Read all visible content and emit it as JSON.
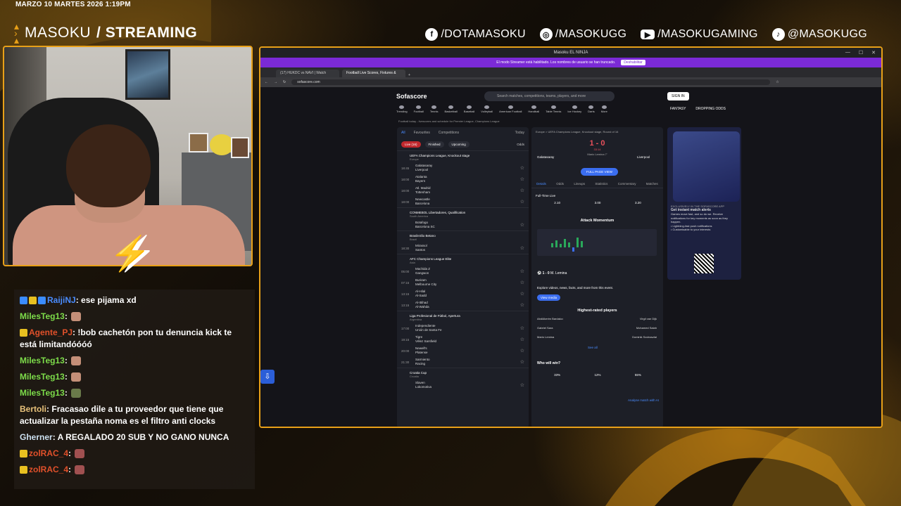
{
  "overlay": {
    "datetime": "MARZO 10 MARTES 2026 1:19PM",
    "brand_light": "MASOKU",
    "brand_bold": "/ STREAMING",
    "socials": [
      {
        "icon": "facebook-icon",
        "label": "/DOTAMASOKU"
      },
      {
        "icon": "instagram-icon",
        "label": "/MASOKUGG"
      },
      {
        "icon": "youtube-icon",
        "label": "/MASOKUGAMING"
      },
      {
        "icon": "tiktok-icon",
        "label": "@MASOKUGG"
      }
    ],
    "accent": "#e8a018"
  },
  "chat": {
    "messages": [
      {
        "user": "RaijiNJ",
        "color": "#4a8cff",
        "text": "ese pijama xd"
      },
      {
        "user": "MilesTeg13",
        "color": "#7ddc4a",
        "text": ""
      },
      {
        "user": "Agente_PJ",
        "color": "#e0502a",
        "text": "!bob cachetón pon tu denuncia kick te está limitandóóóó"
      },
      {
        "user": "MilesTeg13",
        "color": "#7ddc4a",
        "text": ""
      },
      {
        "user": "MilesTeg13",
        "color": "#7ddc4a",
        "text": ""
      },
      {
        "user": "MilesTeg13",
        "color": "#7ddc4a",
        "text": ""
      },
      {
        "user": "Bertoli",
        "color": "#e8c27a",
        "text": "Fracasao dile a tu proveedor que tiene que actualizar la pestaña noma es el filtro anti clocks"
      },
      {
        "user": "Gherner",
        "color": "#cde0f0",
        "text": "A REGALADO 20 SUB Y NO GANO NUNCA"
      },
      {
        "user": "zolRAC_4",
        "color": "#e0502a",
        "text": ""
      },
      {
        "user": "zolRAC_4",
        "color": "#e0502a",
        "text": ""
      }
    ]
  },
  "browser": {
    "title": "Masoku EL NINJA",
    "stream_notice": "El modo Streamer está habilitado. Los nombres de usuario se han truncado.",
    "stream_button": "Deshabilitar",
    "tabs": [
      "(17) HUKDC vs NAVI | Watch",
      "Football Live Scores, Fixtures &"
    ],
    "url": "sofascore.com"
  },
  "sofascore": {
    "logo": "Sofascore",
    "search_placeholder": "Search matches, competitions, teams, players, and more",
    "signin": "SIGN IN",
    "nav": [
      "Trending",
      "Football",
      "Tennis",
      "Basketball",
      "Baseball",
      "Volleyball",
      "American Football",
      "Handball",
      "Table Tennis",
      "Ice Hockey",
      "Darts",
      "More"
    ],
    "fantasy": "FANTASY",
    "dropping_odds": "DROPPING ODDS",
    "breadcrumb": "Football today - livescores and schedule for Premier League, Champions League",
    "match_tabs": [
      "All",
      "Favourites",
      "Competitions"
    ],
    "date_label": "Today",
    "filters": [
      "Live (16)",
      "Finished",
      "Upcoming"
    ],
    "odds_label": "Odds",
    "leagues": [
      {
        "name": "UEFA Champions League, Knockout stage",
        "region": "Europe",
        "games": [
          {
            "time": "18:45",
            "home": "Galatasaray",
            "away": "Liverpool"
          },
          {
            "time": "18:00",
            "home": "Atalanta",
            "away": "Bayern"
          },
          {
            "time": "18:00",
            "home": "Atl. Madrid",
            "away": "Tottenham"
          },
          {
            "time": "18:00",
            "home": "Newcastle",
            "away": "Barcelona"
          }
        ]
      },
      {
        "name": "CONMEBOL Libertadores, Qualification",
        "region": "South America",
        "games": [
          {
            "time": "",
            "home": "Botafogo",
            "away": "Barcelona SC"
          }
        ]
      },
      {
        "name": "Brasileirão Betano",
        "region": "Brazil",
        "games": [
          {
            "time": "18:30",
            "home": "Mirassol",
            "away": "Santos"
          }
        ]
      },
      {
        "name": "AFC Champions League Elite",
        "region": "Asia",
        "games": [
          {
            "time": "05:00",
            "home": "Machida Z",
            "away": "Gangwon"
          },
          {
            "time": "07:15",
            "home": "Buriram",
            "away": "Melbourne City"
          },
          {
            "time": "13:15",
            "home": "Al-Hilal",
            "away": "Al-Sadd"
          },
          {
            "time": "13:15",
            "home": "Al-Ittihad",
            "away": "Al-Wahda"
          }
        ]
      },
      {
        "name": "Liga Profesional de Fútbol, Apertura",
        "region": "Argentina",
        "games": [
          {
            "time": "17:00",
            "home": "Independiente",
            "away": "Unión de Santa Fe"
          },
          {
            "time": "19:15",
            "home": "Tigre",
            "away": "Vélez Sarsfield"
          },
          {
            "time": "20:00",
            "home": "Newell's",
            "away": "Platense"
          },
          {
            "time": "21:30",
            "home": "Sarmiento",
            "away": "Racing"
          }
        ]
      },
      {
        "name": "Croatia Cup",
        "region": "Croatia",
        "games": [
          {
            "time": "",
            "home": "Slaven",
            "away": "Lokomotiva"
          }
        ]
      }
    ],
    "detail": {
      "header": "Europe > UEFA Champions League, Knockout stage, Round of 16",
      "home": "Galatasaray",
      "away": "Liverpool",
      "score": "1 - 0",
      "minute": "33:14",
      "scorer": "Mario Lemina 7'",
      "full_page": "FULL PAGE VIEW",
      "tabs": [
        "Details",
        "Odds",
        "Lineups",
        "Statistics",
        "Commentary",
        "Matches"
      ],
      "fulltime_label": "Full-Time Live",
      "odds": [
        "2.10",
        "3.00",
        "3.20"
      ],
      "momentum_title": "Attack Momentum",
      "goal_text": "M. Lemina",
      "explore_text": "Explore videos, news, facts, and more from this event.",
      "view_media": "View media",
      "rated_title": "Highest-rated players",
      "rated": [
        [
          "Abdülkerim Bardakcı",
          "Virgil van Dijk"
        ],
        [
          "Gabriel Sara",
          "Mohamed Salah"
        ],
        [
          "Mario Lemina",
          "Dominik Szoboszlai"
        ]
      ],
      "see_all": "See all",
      "win_title": "Who will win?",
      "win_votes": [
        "33%",
        "12%",
        "55%"
      ],
      "analyse": "Analyse match with AI"
    },
    "promo": {
      "kicker": "EXCLUSIVELY IN THE SOFASCORE APP",
      "title": "Get instant match alerts",
      "body": "Games move fast, and so do we. Receive notifications for key moments as soon as they happen.",
      "bullets": [
        "Lightning-fast push notifications",
        "Customisable to your interests"
      ]
    }
  }
}
